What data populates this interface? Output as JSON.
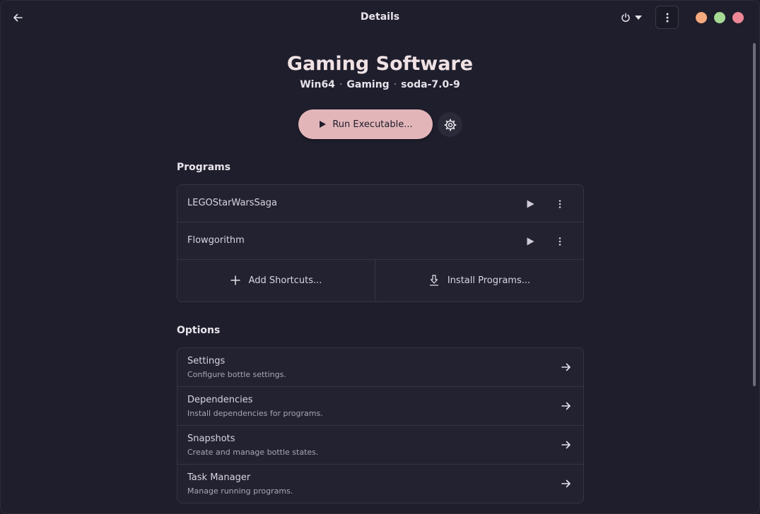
{
  "header": {
    "title": "Details"
  },
  "bottle": {
    "name": "Gaming Software",
    "arch": "Win64",
    "environment": "Gaming",
    "runner": "soda-7.0-9",
    "separator": "·",
    "run_label": "Run Executable..."
  },
  "programs": {
    "heading": "Programs",
    "items": [
      {
        "name": "LEGOStarWarsSaga"
      },
      {
        "name": "Flowgorithm"
      }
    ],
    "add_shortcuts_label": "Add Shortcuts...",
    "install_programs_label": "Install Programs..."
  },
  "options": {
    "heading": "Options",
    "items": [
      {
        "title": "Settings",
        "subtitle": "Configure bottle settings."
      },
      {
        "title": "Dependencies",
        "subtitle": "Install dependencies for programs."
      },
      {
        "title": "Snapshots",
        "subtitle": "Create and manage bottle states."
      },
      {
        "title": "Task Manager",
        "subtitle": "Manage running programs."
      }
    ]
  },
  "colors": {
    "background": "#1f1e2c",
    "accent": "#e2b6b9",
    "minimize": "#f5a97f",
    "maximize": "#a6da95",
    "close": "#ed8796"
  },
  "icons": {
    "back": "arrow-left-icon",
    "power": "power-icon",
    "menu": "kebab-menu-icon",
    "run": "play-icon",
    "gear": "gear-icon",
    "add": "plus-icon",
    "install": "download-icon",
    "option": "arrow-right-icon"
  }
}
